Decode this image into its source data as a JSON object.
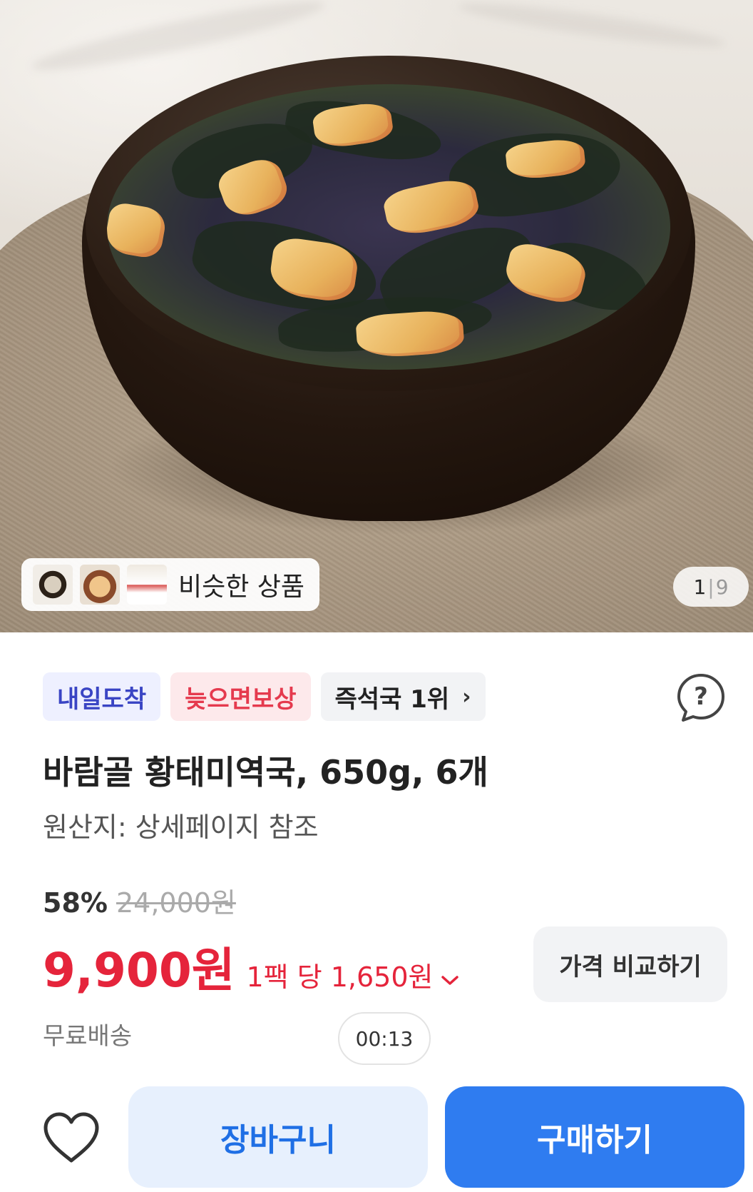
{
  "gallery": {
    "similar_label": "비슷한 상품",
    "page_current": "1",
    "page_total": "9"
  },
  "badges": {
    "tomorrow": "내일도착",
    "late_comp": "늦으면보상",
    "rank": "즉석국 1위"
  },
  "product": {
    "title": "바람골 황태미역국, 650g, 6개",
    "origin": "원산지: 상세페이지 참조"
  },
  "price": {
    "discount": "58%",
    "original": "24,000원",
    "sale": "9,900원",
    "unit": "1팩 당 1,650원",
    "compare_label": "가격 비교하기"
  },
  "shipping": {
    "label": "무료배송"
  },
  "timer": {
    "value": "00:13"
  },
  "actions": {
    "cart_label": "장바구니",
    "buy_label": "구매하기"
  },
  "colors": {
    "accent_red": "#e5243b",
    "accent_blue": "#2f7cf0",
    "badge_blue_text": "#3a45c4"
  },
  "icons": {
    "help": "question-bubble-icon",
    "wish": "heart-outline-icon",
    "rank_arrow": "chevron-right-icon",
    "unit_arrow": "chevron-down-icon"
  }
}
